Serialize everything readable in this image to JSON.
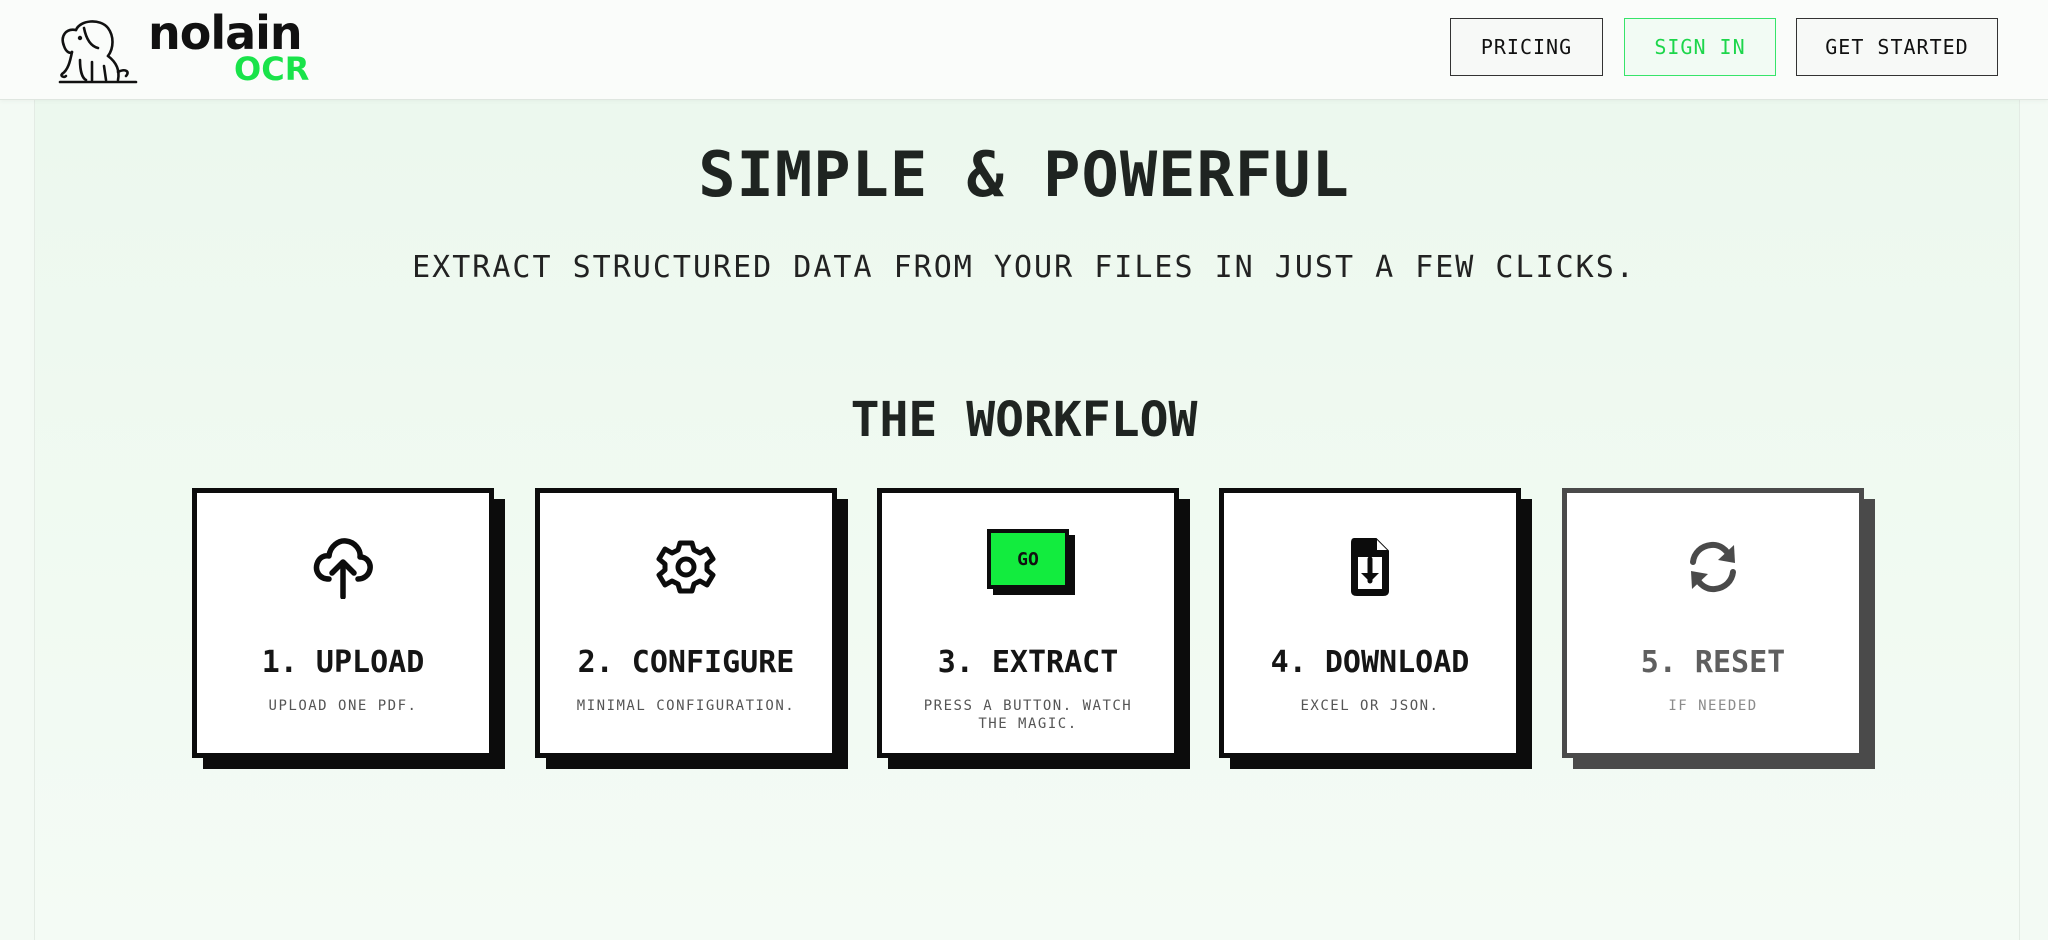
{
  "brand": {
    "name": "nolain",
    "sub": "OCR",
    "accent": "#19e34a"
  },
  "nav": {
    "pricing": "PRICING",
    "sign_in": "SIGN IN",
    "get_started": "GET STARTED"
  },
  "hero": {
    "title": "SIMPLE & POWERFUL",
    "subtitle": "EXTRACT STRUCTURED DATA FROM YOUR FILES IN JUST A FEW CLICKS."
  },
  "workflow": {
    "title": "THE WORKFLOW",
    "steps": [
      {
        "title": "1. UPLOAD",
        "desc": "UPLOAD ONE PDF.",
        "icon": "cloud-upload-icon"
      },
      {
        "title": "2. CONFIGURE",
        "desc": "MINIMAL CONFIGURATION.",
        "icon": "gear-icon"
      },
      {
        "title": "3. EXTRACT",
        "desc": "PRESS A BUTTON. WATCH THE MAGIC.",
        "icon": "go-button-icon",
        "button_label": "GO"
      },
      {
        "title": "4. DOWNLOAD",
        "desc": "EXCEL OR JSON.",
        "icon": "file-download-icon"
      },
      {
        "title": "5. RESET",
        "desc": "IF NEEDED",
        "icon": "refresh-icon"
      }
    ]
  }
}
